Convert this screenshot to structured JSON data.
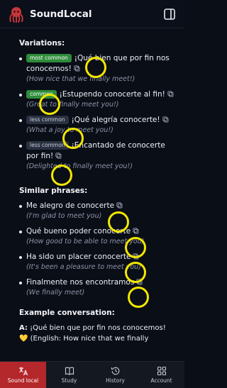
{
  "app": {
    "title": "SoundLocal"
  },
  "sections": {
    "variations_title": "Variations:",
    "similar_title": "Similar phrases:",
    "example_title": "Example conversation:"
  },
  "variations": [
    {
      "badge": "most common",
      "phrase": "¡Qué bien que por fin nos conocemos!",
      "translation": "(How nice that we finally meet!)"
    },
    {
      "badge": "common",
      "phrase": "¡Estupendo conocerte al fin!",
      "translation": "(Great to finally meet you!)"
    },
    {
      "badge": "less common",
      "phrase": "¡Qué alegría conocerte!",
      "translation": "(What a joy to meet you!)"
    },
    {
      "badge": "less common",
      "phrase": "¡Encantado de conocerte por fin!",
      "translation": "(Delighted to finally meet you!)"
    }
  ],
  "similar": [
    {
      "phrase": "Me alegro de conocerte",
      "translation": "(I'm glad to meet you)"
    },
    {
      "phrase": "Qué bueno poder conocerte",
      "translation": "(How good to be able to meet you)"
    },
    {
      "phrase": "Ha sido un placer conocerte",
      "translation": "(It's been a pleasure to meet you)"
    },
    {
      "phrase": "Finalmente nos encontramos",
      "translation": "(We finally meet)"
    }
  ],
  "conversation": {
    "speaker": "A:",
    "line": "¡Qué bien que por fin nos conocemos!",
    "emoji": "💛",
    "translation_cut": "(English: How nice that we finally"
  },
  "nav": [
    {
      "label": "Sound local",
      "icon": "translate-icon",
      "active": true
    },
    {
      "label": "Study",
      "icon": "book-icon",
      "active": false
    },
    {
      "label": "History",
      "icon": "history-icon",
      "active": false
    },
    {
      "label": "Account",
      "icon": "grid-icon",
      "active": false
    }
  ],
  "colors": {
    "accent": "#b4272a",
    "badge_most": "#2e8b3a",
    "badge_less": "#2a3140",
    "highlight_ring": "#f2e600"
  }
}
